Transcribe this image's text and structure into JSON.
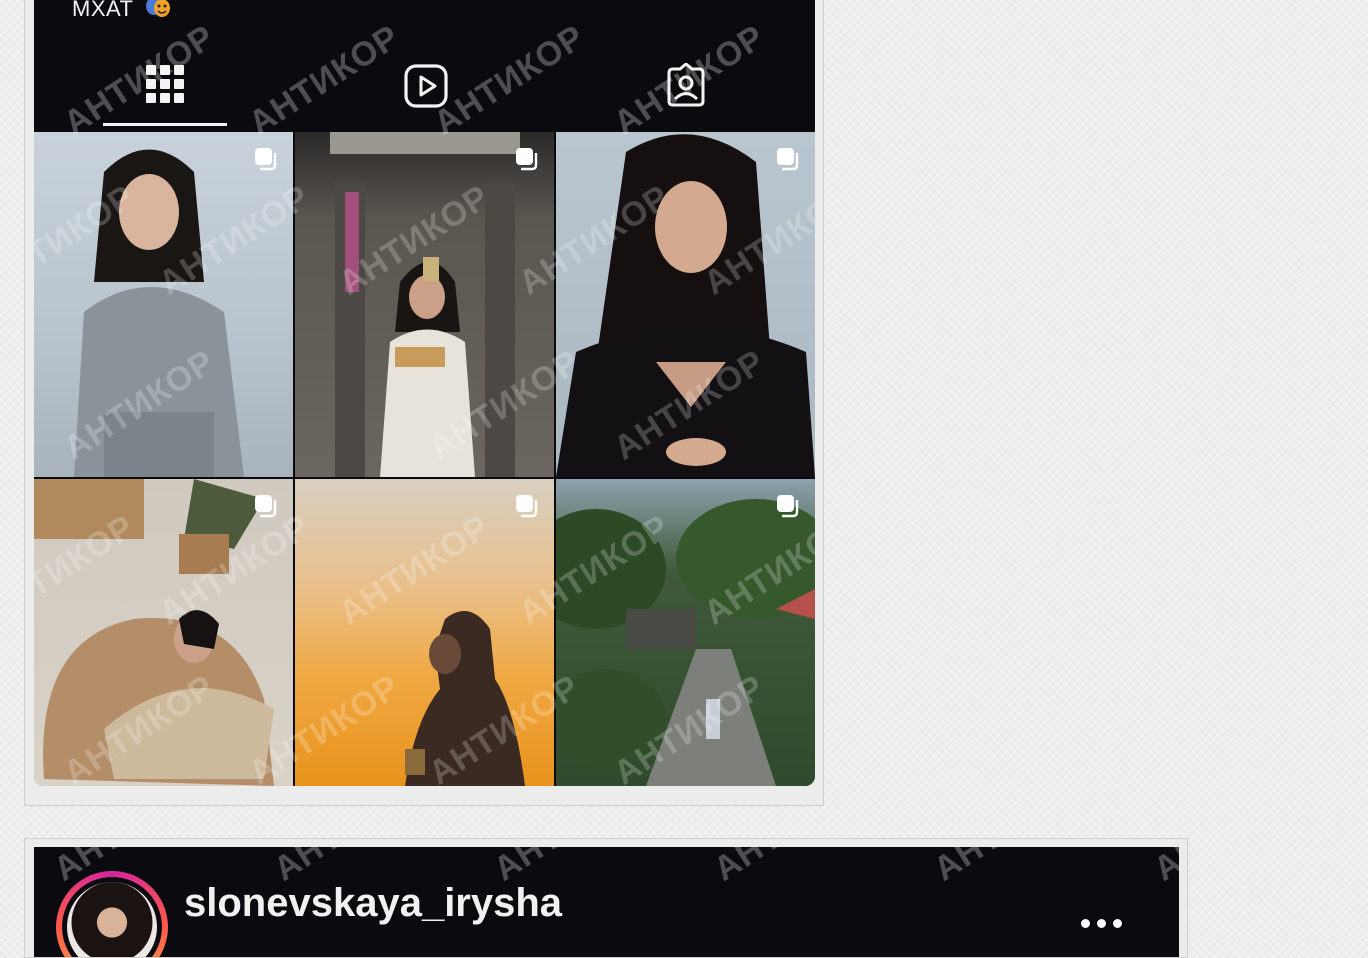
{
  "profile": {
    "bio_text": "МХАТ",
    "bio_emoji": "theater-masks-icon",
    "username": "slonevskaya_irysha"
  },
  "tabs": [
    {
      "name": "posts-grid-icon",
      "selected": true
    },
    {
      "name": "reels-icon",
      "selected": false
    },
    {
      "name": "tagged-icon",
      "selected": false
    }
  ],
  "watermark": "АНТИКОР",
  "posts": [
    {
      "id": "post-1",
      "subject": "woman in grey cardigan on white background",
      "multi": true
    },
    {
      "id": "post-2",
      "subject": "elevator mirror selfie in white robe with cake",
      "multi": true
    },
    {
      "id": "post-3",
      "subject": "woman in black top portrait",
      "multi": true
    },
    {
      "id": "post-4",
      "subject": "woman lounging on beige bean bag",
      "multi": true
    },
    {
      "id": "post-5",
      "subject": "silhouette against orange sunset sky",
      "multi": true
    },
    {
      "id": "post-6",
      "subject": "jungle path with person walking",
      "multi": true
    }
  ],
  "colors": {
    "app_bg": "#0b0b0f",
    "page_bg": "#f1f1f1",
    "story_ring_start": "#d6249f",
    "story_ring_end": "#fdbd4f"
  }
}
